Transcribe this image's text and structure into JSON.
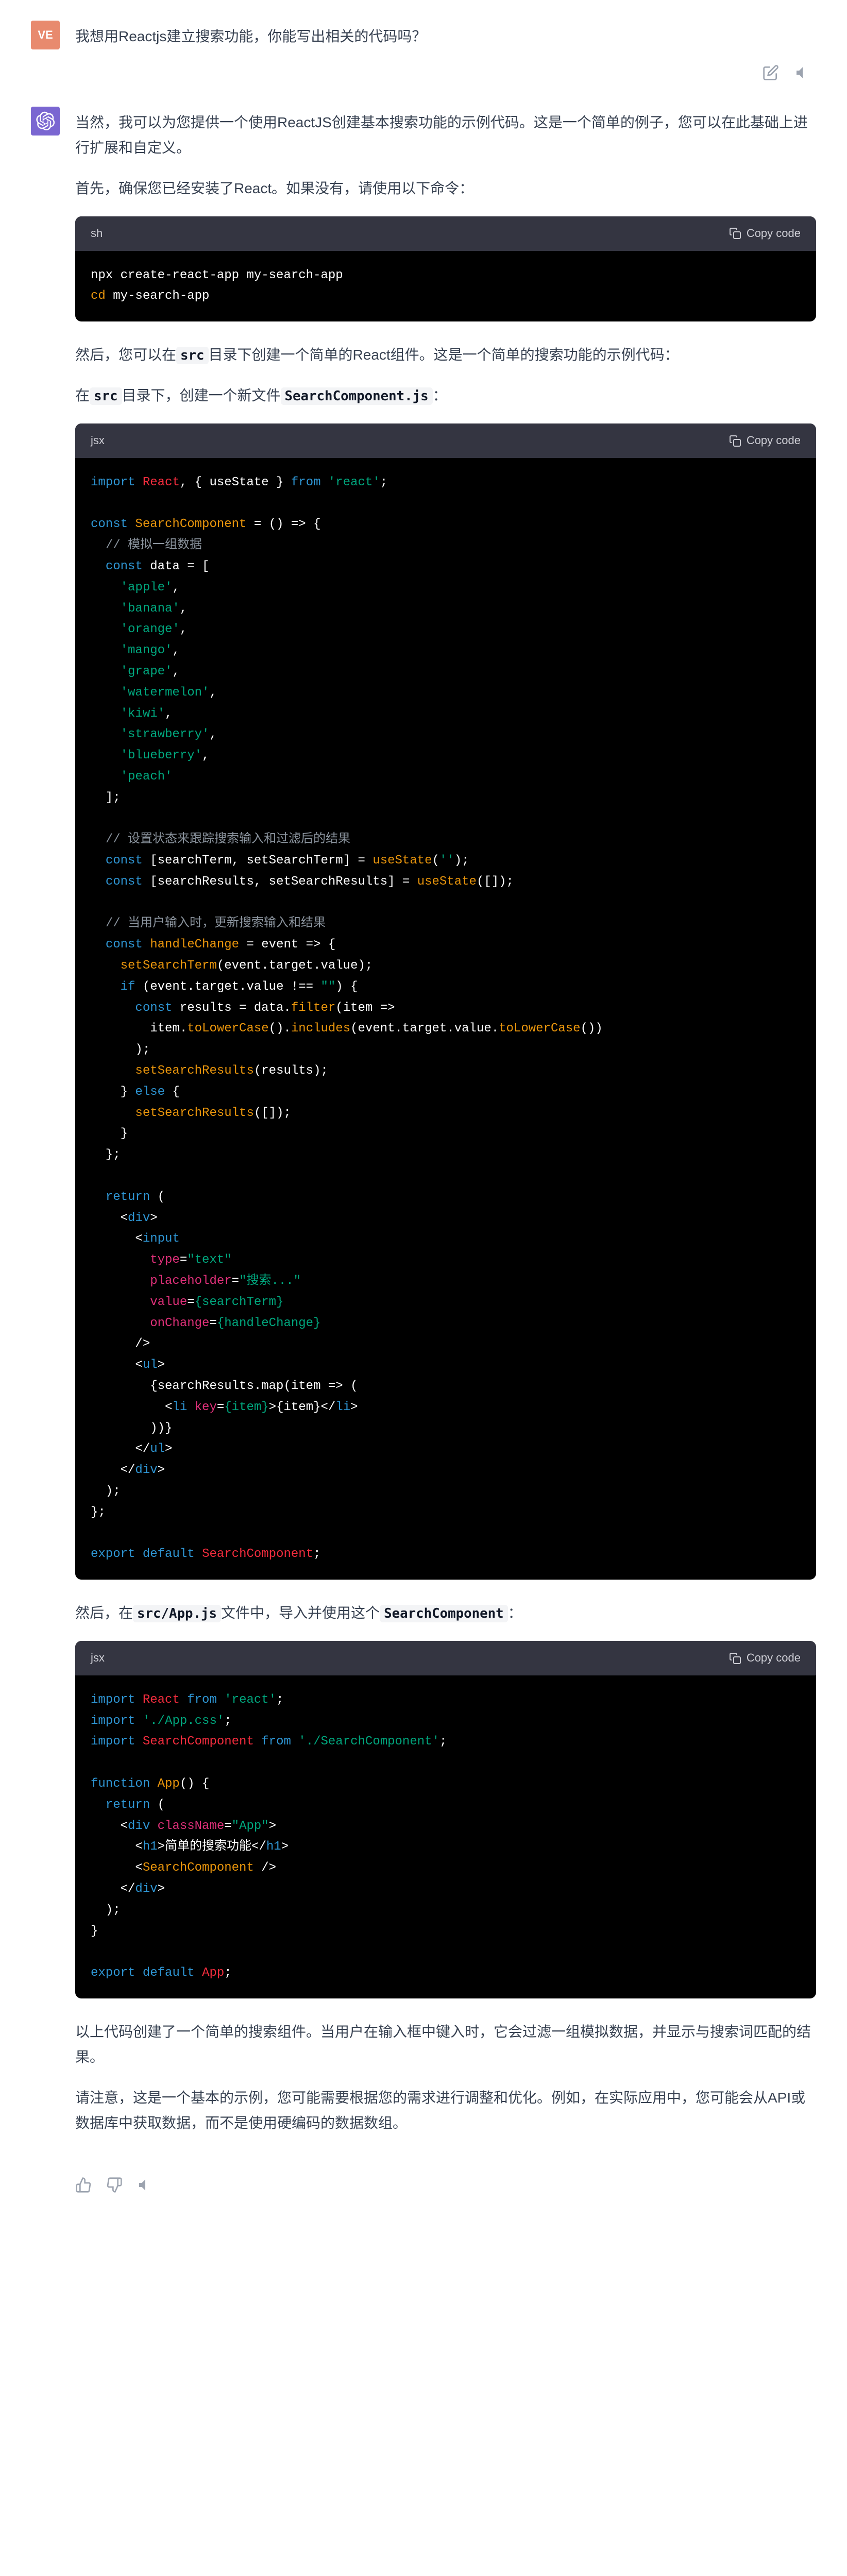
{
  "user": {
    "avatar": "VE",
    "message": "我想用Reactjs建立搜索功能，你能写出相关的代码吗？"
  },
  "assistant": {
    "p1": "当然，我可以为您提供一个使用ReactJS创建基本搜索功能的示例代码。这是一个简单的例子，您可以在此基础上进行扩展和自定义。",
    "p2": "首先，确保您已经安装了React。如果没有，请使用以下命令：",
    "p3_1": "然后，您可以在",
    "p3_code": "src",
    "p3_2": "目录下创建一个简单的React组件。这是一个简单的搜索功能的示例代码：",
    "p4_1": "在",
    "p4_code1": "src",
    "p4_2": "目录下，创建一个新文件",
    "p4_code2": "SearchComponent.js",
    "p4_3": "：",
    "p5_1": "然后，在",
    "p5_code": "src/App.js",
    "p5_2": "文件中，导入并使用这个",
    "p5_code2": "SearchComponent",
    "p5_3": "：",
    "p6": "以上代码创建了一个简单的搜索组件。当用户在输入框中键入时，它会过滤一组模拟数据，并显示与搜索词匹配的结果。",
    "p7": "请注意，这是一个基本的示例，您可能需要根据您的需求进行调整和优化。例如，在实际应用中，您可能会从API或数据库中获取数据，而不是使用硬编码的数据数组。"
  },
  "code1": {
    "lang": "sh",
    "copy": "Copy code",
    "line1_a": "npx create-react-app my-search-app",
    "line2_a": "cd",
    "line2_b": " my-search-app"
  },
  "code2": {
    "lang": "jsx",
    "copy": "Copy code",
    "c_import": "import",
    "c_react": "React",
    "c_usestate": "useState",
    "c_from": "from",
    "c_reactstr": "'react'",
    "c_const": "const",
    "c_searchcomp": "SearchComponent",
    "c_arrow": " = () => {",
    "c_comment1": "// 模拟一组数据",
    "c_data": " data = [",
    "c_fruits": [
      "'apple'",
      "'banana'",
      "'orange'",
      "'mango'",
      "'grape'",
      "'watermelon'",
      "'kiwi'",
      "'strawberry'",
      "'blueberry'",
      "'peach'"
    ],
    "c_comment2": "// 设置状态来跟踪搜索输入和过滤后的结果",
    "c_st1": " [searchTerm, setSearchTerm] = ",
    "c_us": "useState",
    "c_st2": " [searchResults, setSearchResults] = ",
    "c_comment3": "// 当用户输入时，更新搜索输入和结果",
    "c_handle": "handleChange",
    "c_event": " = event => {",
    "c_sst": "setSearchTerm",
    "c_etv": "(event.target.value);",
    "c_if": "if",
    "c_cond": " (event.target.value !== ",
    "c_empty": "\"\"",
    "c_results": " results = data.",
    "c_filter": "filter",
    "c_item": "(item =>",
    "c_tolower": "toLowerCase",
    "c_includes": "includes",
    "c_etvlower": "(event.target.value.",
    "c_ssr": "setSearchResults",
    "c_resultsv": "(results);",
    "c_else": "else",
    "c_emptyarr": "([]);",
    "c_return": "return",
    "c_div": "div",
    "c_input": "input",
    "c_type": "type",
    "c_text": "\"text\"",
    "c_placeholder": "placeholder",
    "c_phval": "\"搜索...\"",
    "c_value": "value",
    "c_stval": "{searchTerm}",
    "c_onchange": "onChange",
    "c_hcval": "{handleChange}",
    "c_ul": "ul",
    "c_map": "{searchResults.map(item => (",
    "c_li": "li",
    "c_key": "key",
    "c_itemv": "{item}",
    "c_export": "export",
    "c_default": "default",
    "c_sc": "SearchComponent"
  },
  "code3": {
    "lang": "jsx",
    "copy": "Copy code",
    "c_appcss": "'./App.css'",
    "c_scpath": "'./SearchComponent'",
    "c_function": "function",
    "c_app": "App",
    "c_classname": "className",
    "c_appstr": "\"App\"",
    "c_h1": "h1",
    "c_h1text": "简单的搜索功能",
    "c_sccomp": "SearchComponent"
  },
  "chart_data": null
}
